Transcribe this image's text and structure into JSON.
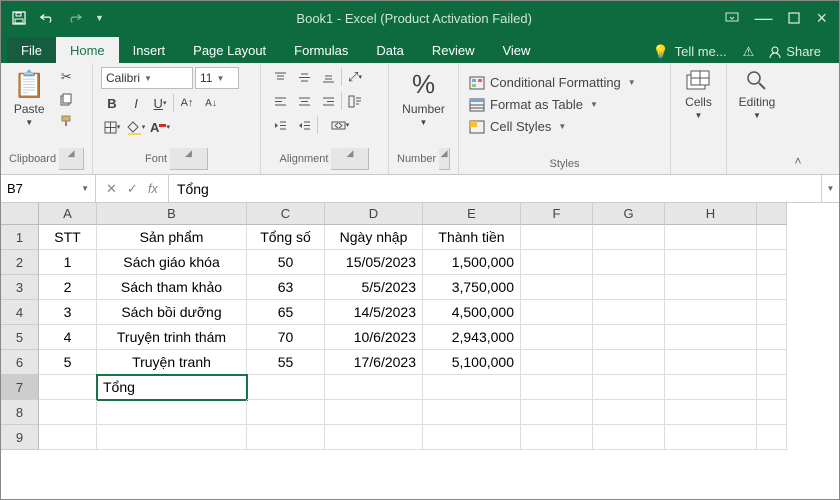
{
  "titlebar": {
    "title": "Book1 - Excel (Product Activation Failed)"
  },
  "tabs": {
    "file": "File",
    "home": "Home",
    "insert": "Insert",
    "page_layout": "Page Layout",
    "formulas": "Formulas",
    "data": "Data",
    "review": "Review",
    "view": "View",
    "tell_me": "Tell me...",
    "share": "Share"
  },
  "ribbon": {
    "clipboard": {
      "label": "Clipboard",
      "paste": "Paste"
    },
    "font": {
      "label": "Font",
      "name": "Calibri",
      "size": "11"
    },
    "alignment": {
      "label": "Alignment"
    },
    "number": {
      "label": "Number",
      "btn": "Number"
    },
    "styles": {
      "label": "Styles",
      "cond": "Conditional Formatting",
      "table": "Format as Table",
      "cell": "Cell Styles"
    },
    "cells": {
      "label": "Cells"
    },
    "editing": {
      "label": "Editing"
    }
  },
  "formula_bar": {
    "name_box": "B7",
    "fx": "fx",
    "value": "Tổng"
  },
  "grid": {
    "cols": [
      "A",
      "B",
      "C",
      "D",
      "E",
      "F",
      "G",
      "H",
      ""
    ],
    "row_nums": [
      "1",
      "2",
      "3",
      "4",
      "5",
      "6",
      "7",
      "8",
      "9"
    ],
    "header": {
      "a": "STT",
      "b": "Sản phẩm",
      "c": "Tổng số",
      "d": "Ngày nhập",
      "e": "Thành tiền"
    },
    "rows": [
      {
        "a": "1",
        "b": "Sách giáo khóa",
        "c": "50",
        "d": "15/05/2023",
        "e": "1,500,000"
      },
      {
        "a": "2",
        "b": "Sách tham khảo",
        "c": "63",
        "d": "5/5/2023",
        "e": "3,750,000"
      },
      {
        "a": "3",
        "b": "Sách bồi dưỡng",
        "c": "65",
        "d": "14/5/2023",
        "e": "4,500,000"
      },
      {
        "a": "4",
        "b": "Truyện trinh thám",
        "c": "70",
        "d": "10/6/2023",
        "e": "2,943,000"
      },
      {
        "a": "5",
        "b": "Truyện tranh",
        "c": "55",
        "d": "17/6/2023",
        "e": "5,100,000"
      }
    ],
    "footer_b": "Tổng"
  }
}
